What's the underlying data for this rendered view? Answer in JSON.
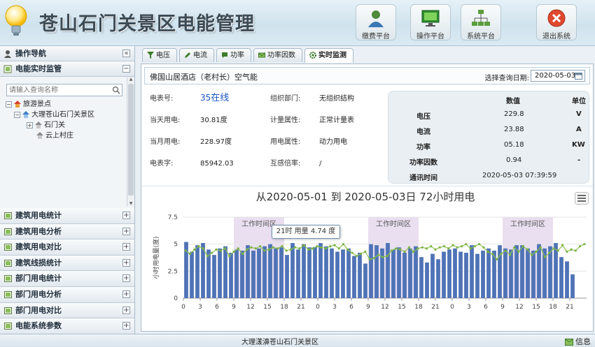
{
  "header": {
    "title": "苍山石门关景区电能管理",
    "buttons": [
      {
        "label": "缴费平台",
        "icon": "user-icon"
      },
      {
        "label": "操作平台",
        "icon": "monitor-icon"
      },
      {
        "label": "系统平台",
        "icon": "network-icon"
      },
      {
        "label": "退出系统",
        "icon": "exit-icon"
      }
    ]
  },
  "sidebar": {
    "nav_title": "操作导航",
    "panel_title": "电能实时监管",
    "search_placeholder": "请输入查询名称",
    "tree": [
      "旅游景点",
      "大理苍山石门关景区",
      "石门关",
      "云上村庄"
    ],
    "menu": [
      "建筑用电统计",
      "建筑用电分析",
      "建筑用电对比",
      "建筑线损统计",
      "部门用电统计",
      "部门用电分析",
      "部门用电对比",
      "电能系统参数"
    ]
  },
  "tabs": [
    "电压",
    "电流",
    "功率",
    "功率因数",
    "实时监测"
  ],
  "info_bar": {
    "location": "佛国山居酒店（老村长）空气能",
    "date_label": "选择查询日期:",
    "date_value": "2020-05-03"
  },
  "meter": {
    "meter_no_label": "电表号:",
    "meter_no_value": "35",
    "online_text": "在线",
    "day_label": "当天用电:",
    "day_value": "30.81度",
    "month_label": "当月用电:",
    "month_value": "228.97度",
    "reading_label": "电表字:",
    "reading_value": "85942.03",
    "dept_label": "组织部门:",
    "dept_value": "无组织结构",
    "meter_attr_label": "计量属性:",
    "meter_attr_value": "正常计量表",
    "usage_attr_label": "用电属性:",
    "usage_attr_value": "动力用电",
    "ct_label": "互感倍率:",
    "ct_value": "/"
  },
  "readings": {
    "header_value": "数值",
    "header_unit": "单位",
    "rows": [
      {
        "name": "电压",
        "value": "229.8",
        "unit": "V"
      },
      {
        "name": "电流",
        "value": "23.88",
        "unit": "A"
      },
      {
        "name": "功率",
        "value": "05.18",
        "unit": "KW"
      },
      {
        "name": "功率因数",
        "value": "0.94",
        "unit": "-"
      },
      {
        "name": "通讯时间",
        "value": "2020-05-03 07:39:59",
        "unit": ""
      }
    ]
  },
  "chart_data": {
    "type": "bar",
    "title": "从2020-05-01 到 2020-05-03日 72小时用电",
    "ylabel": "小时用电量(度)",
    "ylim": [
      0,
      7.5
    ],
    "yticks": [
      0,
      2.5,
      5,
      7.5
    ],
    "xticks": [
      "0",
      "3",
      "6",
      "9",
      "12",
      "15",
      "18",
      "21",
      "0",
      "3",
      "6",
      "9",
      "12",
      "15",
      "18",
      "21",
      "0",
      "3",
      "6",
      "9",
      "12",
      "15",
      "18",
      "21"
    ],
    "band_label": "工作时间区",
    "tooltip": "21时 用量 4.74 度",
    "series": [
      {
        "type": "bar",
        "values": [
          5.2,
          4.3,
          4.9,
          5.1,
          4.5,
          4.0,
          4.6,
          4.8,
          4.2,
          4.5,
          4.4,
          4.9,
          4.4,
          4.6,
          4.8,
          5.0,
          4.6,
          4.7,
          4.0,
          5.1,
          4.5,
          5.0,
          4.7,
          4.74,
          5.1,
          4.8,
          4.6,
          4.3,
          4.5,
          4.6,
          3.9,
          4.2,
          3.2,
          5.0,
          4.9,
          4.6,
          5.1,
          4.5,
          4.7,
          4.2,
          4.6,
          4.8,
          3.8,
          3.3,
          4.1,
          3.6,
          4.3,
          4.5,
          4.6,
          4.3,
          4.2,
          4.9,
          4.1,
          4.4,
          4.6,
          4.4,
          4.9,
          4.6,
          4.5,
          4.9,
          4.9,
          4.6,
          4.4,
          5.0,
          4.6,
          4.8,
          5.1,
          3.8,
          3.4,
          2.2
        ]
      },
      {
        "type": "line",
        "values": [
          4.4,
          4.1,
          4.5,
          4.8,
          4.6,
          3.9,
          4.2,
          4.5,
          4.4,
          4.6,
          3.9,
          4.3,
          4.6,
          4.1,
          4.5,
          4.7,
          4.6,
          4.8,
          4.4,
          4.5,
          4.7,
          4.6,
          4.8,
          4.4,
          4.5,
          4.7,
          4.6,
          4.9,
          4.5,
          4.6,
          4.8,
          4.7,
          4.6,
          4.8,
          4.9,
          4.6,
          5.0,
          4.5,
          4.2,
          3.9,
          4.1,
          4.3,
          3.6,
          3.7,
          4.0,
          3.8,
          3.9,
          4.4,
          4.6,
          4.5,
          4.3,
          4.7,
          4.3,
          4.6,
          4.7,
          4.6,
          4.8,
          4.5,
          4.7,
          4.8,
          4.6,
          4.9,
          4.7,
          4.8,
          5.0,
          4.6,
          4.8,
          5.0,
          4.7,
          4.3,
          4.1,
          3.6,
          4.1,
          4.4,
          4.0,
          4.7,
          4.3,
          4.8,
          4.5,
          4.0,
          4.3,
          4.7,
          3.8,
          4.2,
          4.6,
          4.4,
          4.9,
          4.3,
          4.5,
          4.4,
          4.8,
          5.0
        ]
      }
    ]
  },
  "footer": {
    "text": "大理漾濞苍山石门关景区",
    "message": "信息"
  }
}
